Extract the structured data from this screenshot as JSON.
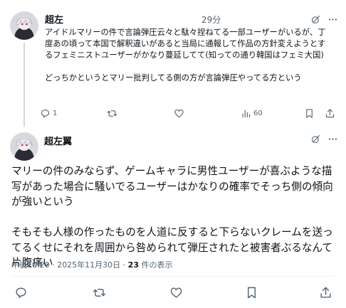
{
  "post1": {
    "display_name": "超左",
    "time": "29分",
    "text": "アイドルマリーの件で言論弾圧云々と駄々捏ねてる一部ユーザーがいるが、丁度あの頃って本国で解釈違いがあると当局に通報して作品の方針変えようとするフェミニストユーザーがかなり蔓延してて(知っての通り韓国はフェミ大国)\n\nどっちかというとマリー批判してる側の方が言論弾圧やってる方という",
    "actions": {
      "reply_count": "1",
      "retweet_count": "",
      "like_count": "",
      "views_count": "60"
    }
  },
  "post2": {
    "display_name": "超左翼",
    "text": "マリーの件のみならず、ゲームキャラに男性ユーザーが喜ぶような描写があった場合に騒いでるユーザーはかなりの確率でそっち側の傾向が強いという\n\nそもそも人様の作ったものを人道に反すると下らないクレームを送ってるくせにそれを周囲から咎められて弾圧されたと被害者ぶるなんて片腹痛い",
    "timestamp": "午後10:20 · 2025年11月30日 · ",
    "views_number": "23",
    "views_label": " 件の表示"
  },
  "icons": {
    "grok": "grok-icon",
    "more": "more-icon",
    "reply": "reply-icon",
    "retweet": "retweet-icon",
    "like": "heart-icon",
    "views": "analytics-icon",
    "bookmark": "bookmark-icon",
    "share": "share-icon"
  },
  "colors": {
    "text": "#0f1419",
    "secondary": "#536471",
    "divider": "#eff3f4",
    "thread_line": "#cfd9de"
  }
}
